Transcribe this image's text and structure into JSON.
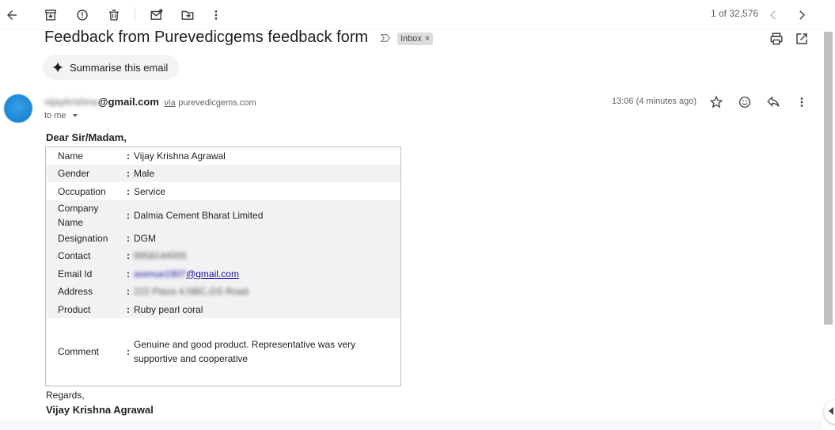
{
  "toolbar": {
    "pager_text": "1 of 32,576",
    "icons": [
      "back-arrow-icon",
      "archive-icon",
      "report-spam-icon",
      "delete-icon",
      "mark-unread-icon",
      "move-to-icon",
      "more-vert-icon",
      "prev-icon",
      "next-icon"
    ]
  },
  "email": {
    "subject": "Feedback from Purevedicgems feedback form",
    "label_chip": "Inbox",
    "label_chip_close": "×",
    "summarise_label": "Summarise this email",
    "sender_user": "vijaykrishna",
    "sender_domain": "@gmail.com",
    "via_text": "via",
    "via_domain": "purevedicgems.com",
    "to_text": "to me",
    "time": "13:06 (4 minutes ago)"
  },
  "body": {
    "greeting": "Dear Sir/Madam,",
    "rows": [
      {
        "label": "Name",
        "value": "Vijay Krishna Agrawal"
      },
      {
        "label": "Gender",
        "value": "Male"
      },
      {
        "label": "Occupation",
        "value": "Service"
      },
      {
        "label": "Company Name",
        "value": "Dalmia Cement Bharat Limited"
      },
      {
        "label": "Designation",
        "value": "DGM"
      },
      {
        "label": "Contact",
        "value": "9958144005"
      },
      {
        "label": "Email Id",
        "value_user": "avenue1907",
        "value_domain": "@gmail.com"
      },
      {
        "label": "Address",
        "value": "222 Plaza 4,NBC,GS Road"
      },
      {
        "label": "Product",
        "value": "Ruby pearl coral"
      },
      {
        "label": "Comment",
        "value": "Genuine and good product. Representative was very supportive and cooperative"
      }
    ],
    "colon": ":",
    "regards": "Regards,",
    "signature": "Vijay Krishna Agrawal"
  }
}
